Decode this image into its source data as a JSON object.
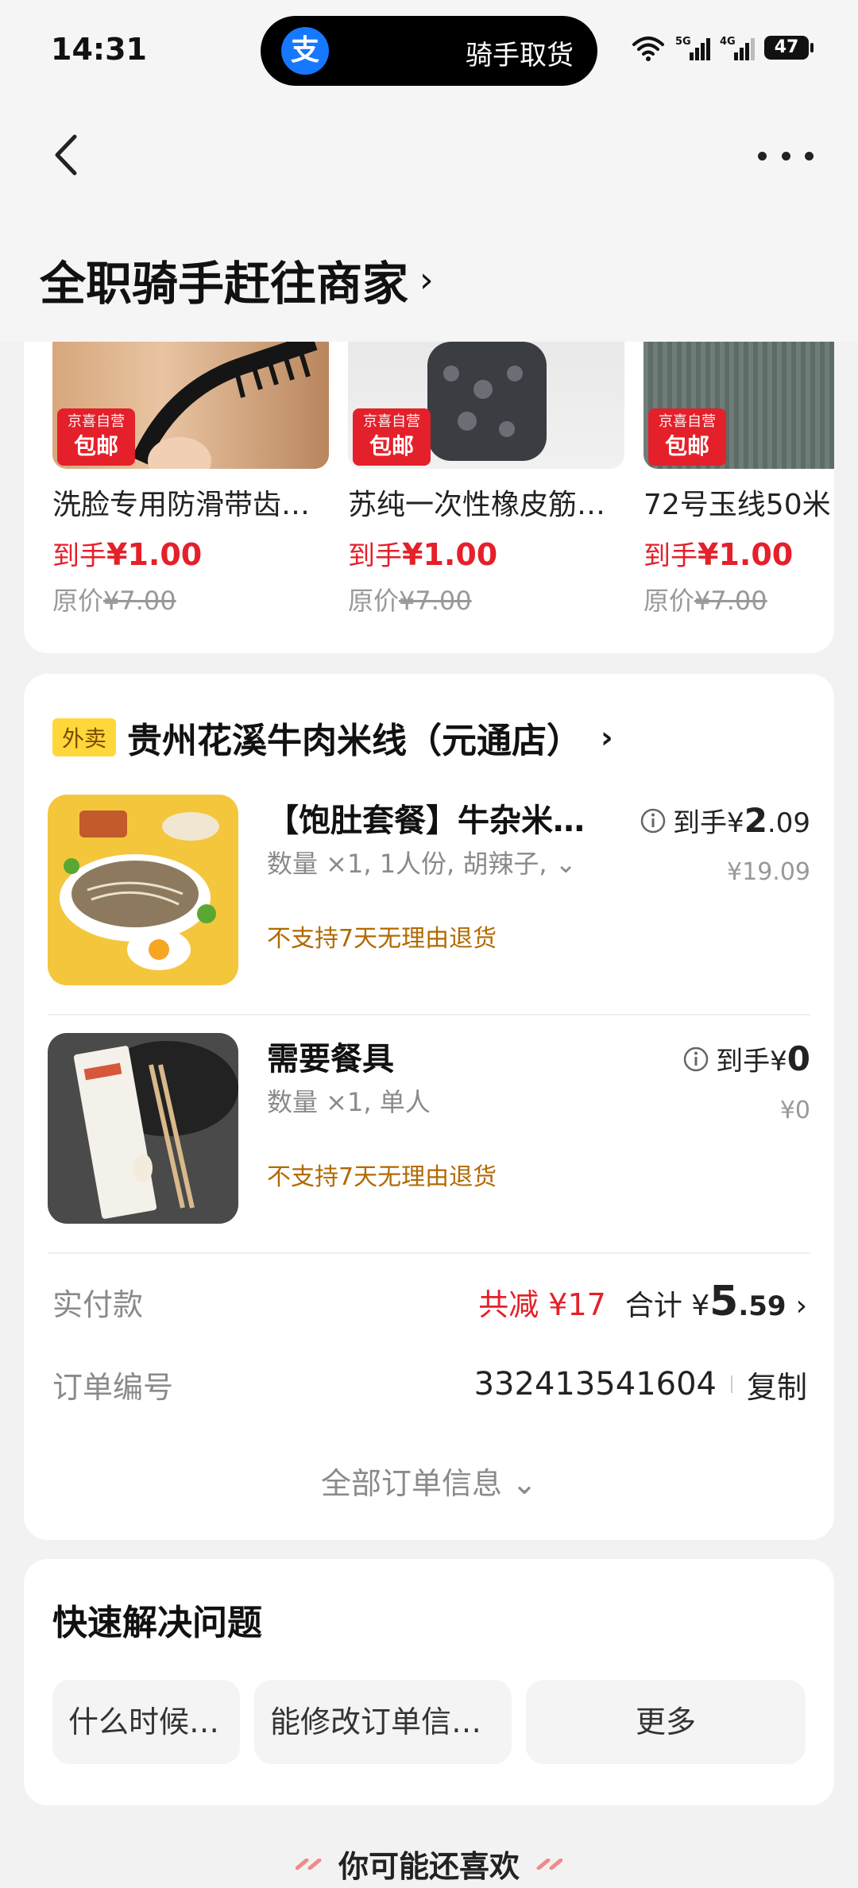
{
  "status_bar": {
    "time": "14:31",
    "island_text": "骑手取货",
    "island_logo": "支",
    "battery": "47"
  },
  "header": {
    "title": "全职骑手赶往商家"
  },
  "products": [
    {
      "name": "洗脸专用防滑带齿…",
      "badge_top": "京喜自营",
      "badge_bottom": "包邮",
      "price_prefix": "到手",
      "price": "¥1.00",
      "orig_prefix": "原价",
      "orig_price": "¥7.00"
    },
    {
      "name": "苏纯一次性橡皮筋…",
      "badge_top": "京喜自营",
      "badge_bottom": "包邮",
      "price_prefix": "到手",
      "price": "¥1.00",
      "orig_prefix": "原价",
      "orig_price": "¥7.00"
    },
    {
      "name": "72号玉线50米",
      "badge_top": "京喜自营",
      "badge_bottom": "包邮",
      "price_prefix": "到手",
      "price": "¥1.00",
      "orig_prefix": "原价",
      "orig_price": "¥7.00"
    }
  ],
  "order": {
    "tag": "外卖",
    "shop_name": "贵州花溪牛肉米线（元通店）",
    "items": [
      {
        "title": "【饱肚套餐】牛杂米…",
        "spec": "数量 ×1, 1人份, 胡辣子, ⌄",
        "warning": "不支持7天无理由退货",
        "price_prefix": "到手¥",
        "price_int": "2",
        "price_dec": ".09",
        "orig": "¥19.09"
      },
      {
        "title": "需要餐具",
        "spec": "数量 ×1, 单人",
        "warning": "不支持7天无理由退货",
        "price_prefix": "到手¥",
        "price_int": "0",
        "price_dec": "",
        "orig": "¥0"
      }
    ],
    "pay_label": "实付款",
    "discount": "共减 ¥17",
    "total_prefix": "合计 ¥",
    "total_int": "5",
    "total_dec": ".59",
    "order_no_label": "订单编号",
    "order_no": "332413541604",
    "copy_label": "复制",
    "all_info": "全部订单信息 ⌄"
  },
  "help": {
    "title": "快速解决问题",
    "buttons": [
      "什么时候送达",
      "能修改订单信息吗",
      "更多"
    ]
  },
  "recommend": "你可能还喜欢",
  "colors": {
    "accent_red": "#e4202a",
    "warn_brown": "#b26a00",
    "brand_blue": "#1677ff"
  }
}
